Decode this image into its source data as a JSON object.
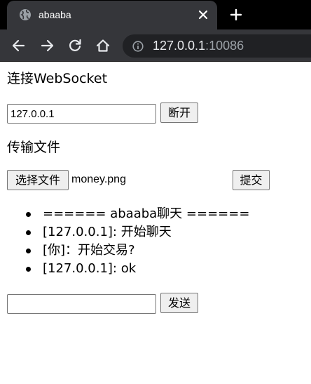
{
  "browser": {
    "tab_title": "abaaba",
    "url_host": "127.0.0.1",
    "url_port": ":10086",
    "icons": {
      "favicon": "globe-icon",
      "close": "close-icon",
      "new_tab": "plus-icon",
      "back": "back-arrow-icon",
      "forward": "forward-arrow-icon",
      "reload": "reload-icon",
      "home": "home-icon",
      "site_info": "info-icon"
    }
  },
  "connect": {
    "heading": "连接WebSocket",
    "address_value": "127.0.0.1",
    "disconnect_label": "断开"
  },
  "file": {
    "heading": "传输文件",
    "choose_label": "选择文件",
    "filename": "money.png",
    "submit_label": "提交"
  },
  "chat": {
    "messages": [
      "====== abaaba聊天 ======",
      "[127.0.0.1]: 开始聊天",
      "[你]：开始交易?",
      "[127.0.0.1]: ok"
    ],
    "input_value": "",
    "send_label": "发送"
  },
  "colors": {
    "tabstrip": "#000000",
    "toolbar": "#35363a",
    "omnibox": "#202124",
    "button_bg": "#efefef"
  }
}
